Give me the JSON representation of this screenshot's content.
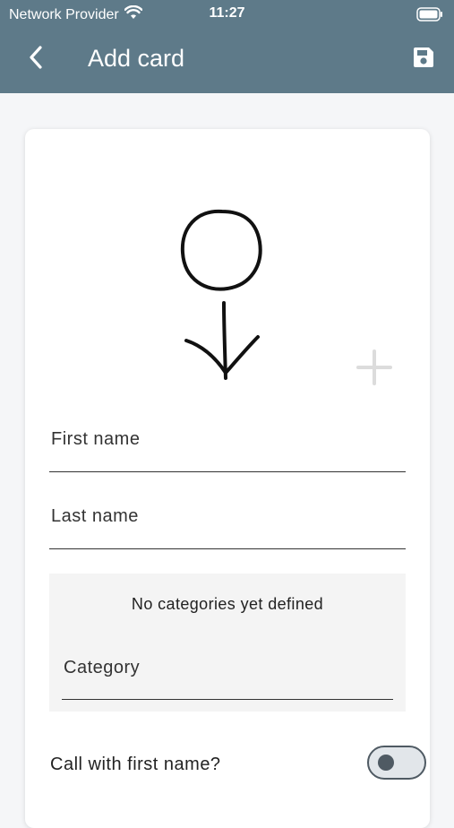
{
  "status_bar": {
    "carrier": "Network Provider",
    "time": "11:27"
  },
  "toolbar": {
    "title": "Add card"
  },
  "form": {
    "first_name_placeholder": "First name",
    "last_name_placeholder": "Last name",
    "categories_note": "No categories yet defined",
    "category_placeholder": "Category",
    "call_first_name_label": "Call with first name?",
    "call_first_name_enabled": false
  },
  "icons": {
    "back": "chevron-left-icon",
    "save": "floppy-disk-icon",
    "add_photo": "plus-icon",
    "avatar": "stick-figure-avatar-icon"
  },
  "colors": {
    "appbar": "#5e7a89",
    "background": "#f5f6f8",
    "card": "#ffffff",
    "category_bg": "#f4f4f4",
    "switch_track": "#e2e6ea",
    "switch_knob": "#4f5a63"
  }
}
